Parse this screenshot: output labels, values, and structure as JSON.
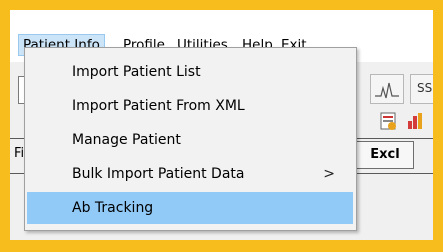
{
  "menubar": {
    "items": [
      "Patient Info",
      "Profile",
      "Utilities",
      "Help",
      "Exit"
    ]
  },
  "toolbar": {
    "icons": [
      "waveform-icon",
      "ss-icon",
      "report-icon",
      "chart-icon"
    ]
  },
  "partial_texts": {
    "left_label": "Fi",
    "ss_label": "SS"
  },
  "grid": {
    "button_label": "Excl"
  },
  "dropdown": {
    "items": [
      {
        "label": "Import Patient List",
        "has_submenu": false
      },
      {
        "label": "Import Patient From XML",
        "has_submenu": false
      },
      {
        "label": "Manage Patient",
        "has_submenu": false
      },
      {
        "label": "Bulk Import Patient Data",
        "has_submenu": true,
        "arrow": ">"
      },
      {
        "label": "Ab Tracking",
        "has_submenu": false
      }
    ],
    "highlighted_index": 4
  },
  "colors": {
    "frame": "#f7bd1c",
    "highlight": "#91c9f7",
    "menu_active": "#cce4f7"
  }
}
